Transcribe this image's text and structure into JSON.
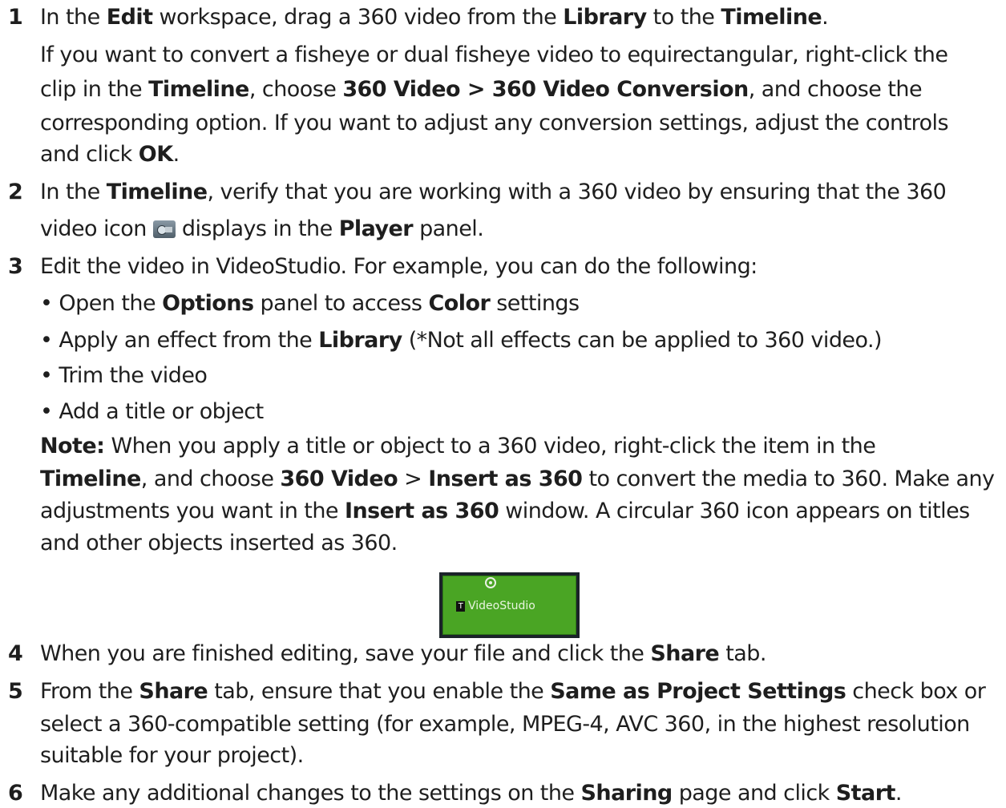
{
  "steps": [
    {
      "number": "1",
      "lines": [
        [
          "In the ",
          "Edit",
          " workspace, drag a 360 video from the ",
          "Library",
          " to the ",
          "Timeline",
          "."
        ],
        [
          "If you want to convert a fisheye or dual fisheye video to equirectangular, right-click the"
        ],
        [
          "clip in the ",
          "Timeline",
          ", choose ",
          "360 Video > 360 Video Conversion",
          ", and choose the"
        ],
        [
          "corresponding option. If you want to adjust any conversion settings, adjust the controls"
        ],
        [
          "and click ",
          "OK",
          "."
        ]
      ]
    },
    {
      "number": "2",
      "lines": [
        [
          "In the ",
          "Timeline",
          ", verify that you are working with a 360 video by ensuring that the 360"
        ],
        [
          "video icon ",
          " displays in the ",
          "Player",
          " panel."
        ]
      ]
    },
    {
      "number": "3",
      "lines": [
        [
          "Edit the video in VideoStudio. For example, you can do the following:"
        ]
      ],
      "bullets": [
        [
          "• Open the ",
          "Options",
          " panel to access ",
          "Color",
          " settings"
        ],
        [
          "• Apply an effect from the ",
          "Library",
          " (*Not all effects can be applied to 360 video.)"
        ],
        [
          "• Trim the video"
        ],
        [
          "• Add a title or object"
        ]
      ],
      "note": [
        [
          "Note:",
          "  When you apply a title or object to a 360 video, right-click the item in the"
        ],
        [
          "Timeline",
          ", and choose ",
          "360 Video",
          " > ",
          "Insert as 360",
          " to convert the media to 360. Make any"
        ],
        [
          "adjustments you want in the ",
          "Insert as 360",
          " window. A circular 360 icon appears on titles"
        ],
        [
          "and other objects inserted as 360."
        ]
      ]
    },
    {
      "number": "4",
      "lines": [
        [
          "When you are finished editing, save your file and click the ",
          "Share",
          " tab."
        ]
      ]
    },
    {
      "number": "5",
      "lines": [
        [
          "From the ",
          "Share",
          " tab, ensure that you enable the ",
          "Same as Project Settings",
          " check box or"
        ],
        [
          "select a 360-compatible setting (for example, MPEG-4, AVC 360, in the highest resolution"
        ],
        [
          "suitable for your project)."
        ]
      ]
    },
    {
      "number": "6",
      "lines": [
        [
          "Make any additional changes to the settings on the ",
          "Sharing",
          " page and click ",
          "Start",
          "."
        ]
      ]
    }
  ],
  "clip_thumbnail": {
    "tag": "T",
    "label": "VideoStudio"
  },
  "icons": {
    "inline_icon": "360-video-icon",
    "thumbnail_icon": "circular-360-icon"
  },
  "colors": {
    "text": "#1e1e1e",
    "clip_green": "#4aa524",
    "clip_frame": "#1b2329"
  }
}
